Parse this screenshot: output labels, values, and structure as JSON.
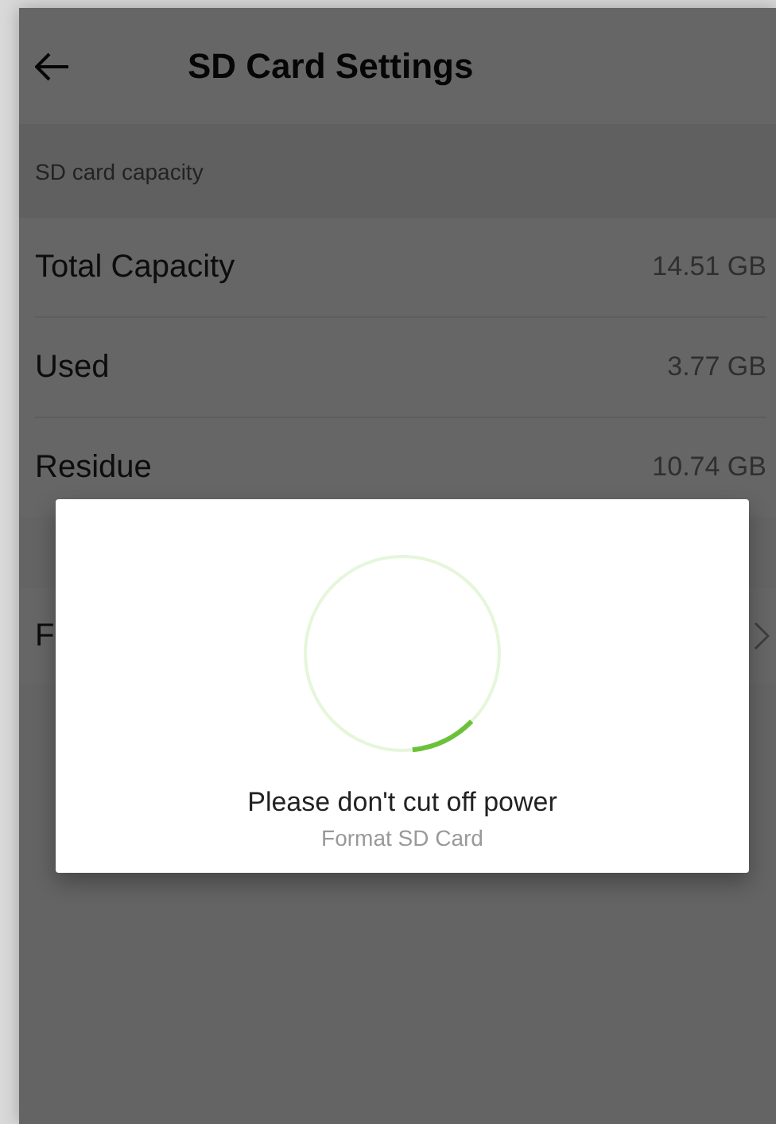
{
  "header": {
    "title": "SD Card Settings"
  },
  "section": {
    "label": "SD card capacity"
  },
  "rows": [
    {
      "label": "Total Capacity",
      "value": "14.51 GB"
    },
    {
      "label": "Used",
      "value": "3.77 GB"
    },
    {
      "label": "Residue",
      "value": "10.74 GB"
    }
  ],
  "action_row": {
    "label": "F"
  },
  "dialog": {
    "progress": {
      "level": 0.11
    },
    "message": "Please don't cut off power",
    "caption": "Format SD Card"
  }
}
